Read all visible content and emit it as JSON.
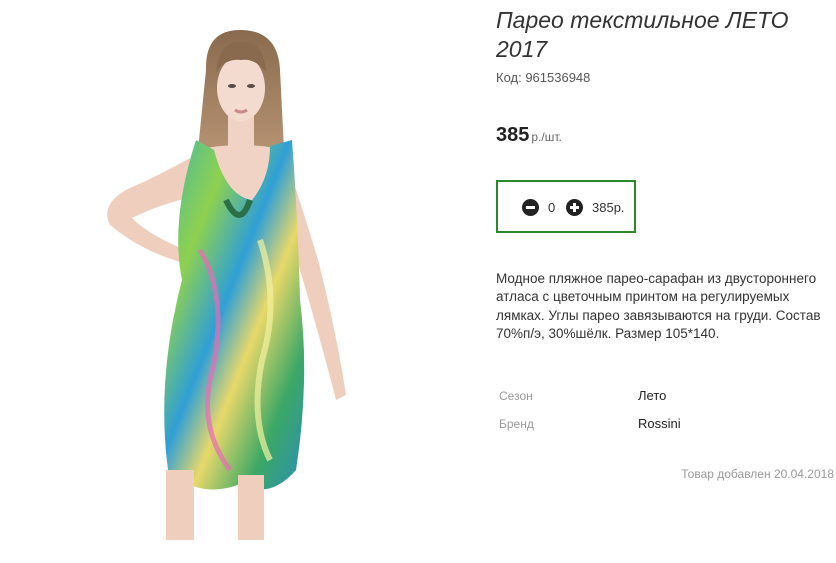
{
  "product": {
    "title": "Парео текстильное ЛЕТО 2017",
    "code_label": "Код: 961536948",
    "price_amount": "385",
    "price_unit": "р./шт.",
    "quantity": "0",
    "quantity_total": "385р.",
    "description": "Модное пляжное парео-сарафан из двустороннего атласа с цветочным принтом на регулируемых лямках. Углы парео завязываются на груди. Состав 70%п/э, 30%шёлк. Размер 105*140.",
    "attributes": [
      {
        "key": "Сезон",
        "value": "Лето"
      },
      {
        "key": "Бренд",
        "value": "Rossini"
      }
    ],
    "added_text": "Товар добавлен 20.04.2018"
  },
  "icons": {
    "minus": "minus-circle-icon",
    "plus": "plus-circle-icon"
  },
  "colors": {
    "qty_border": "#2a8a2a",
    "accent_dark": "#222222"
  }
}
